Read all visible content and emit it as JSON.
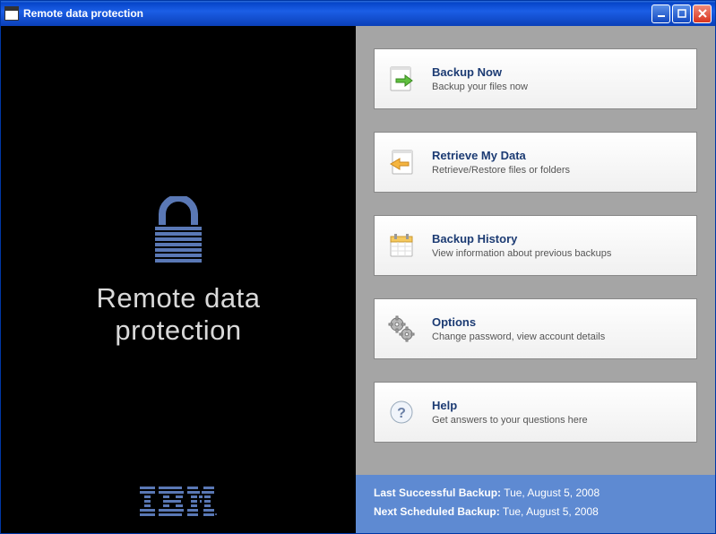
{
  "window": {
    "title": "Remote data protection"
  },
  "left": {
    "title_line1": "Remote data",
    "title_line2": "protection",
    "logo": "IBM"
  },
  "cards": [
    {
      "title": "Backup Now",
      "desc": "Backup your files now",
      "icon": "backup-now-icon"
    },
    {
      "title": "Retrieve My Data",
      "desc": "Retrieve/Restore files or folders",
      "icon": "retrieve-icon"
    },
    {
      "title": "Backup History",
      "desc": "View information about previous backups",
      "icon": "history-icon"
    },
    {
      "title": "Options",
      "desc": "Change password, view account details",
      "icon": "options-icon"
    },
    {
      "title": "Help",
      "desc": "Get answers to your questions here",
      "icon": "help-icon"
    }
  ],
  "status": {
    "last_label": "Last Successful Backup:",
    "last_value": "Tue, August 5, 2008",
    "next_label": "Next Scheduled Backup:",
    "next_value": "Tue, August 5, 2008"
  }
}
